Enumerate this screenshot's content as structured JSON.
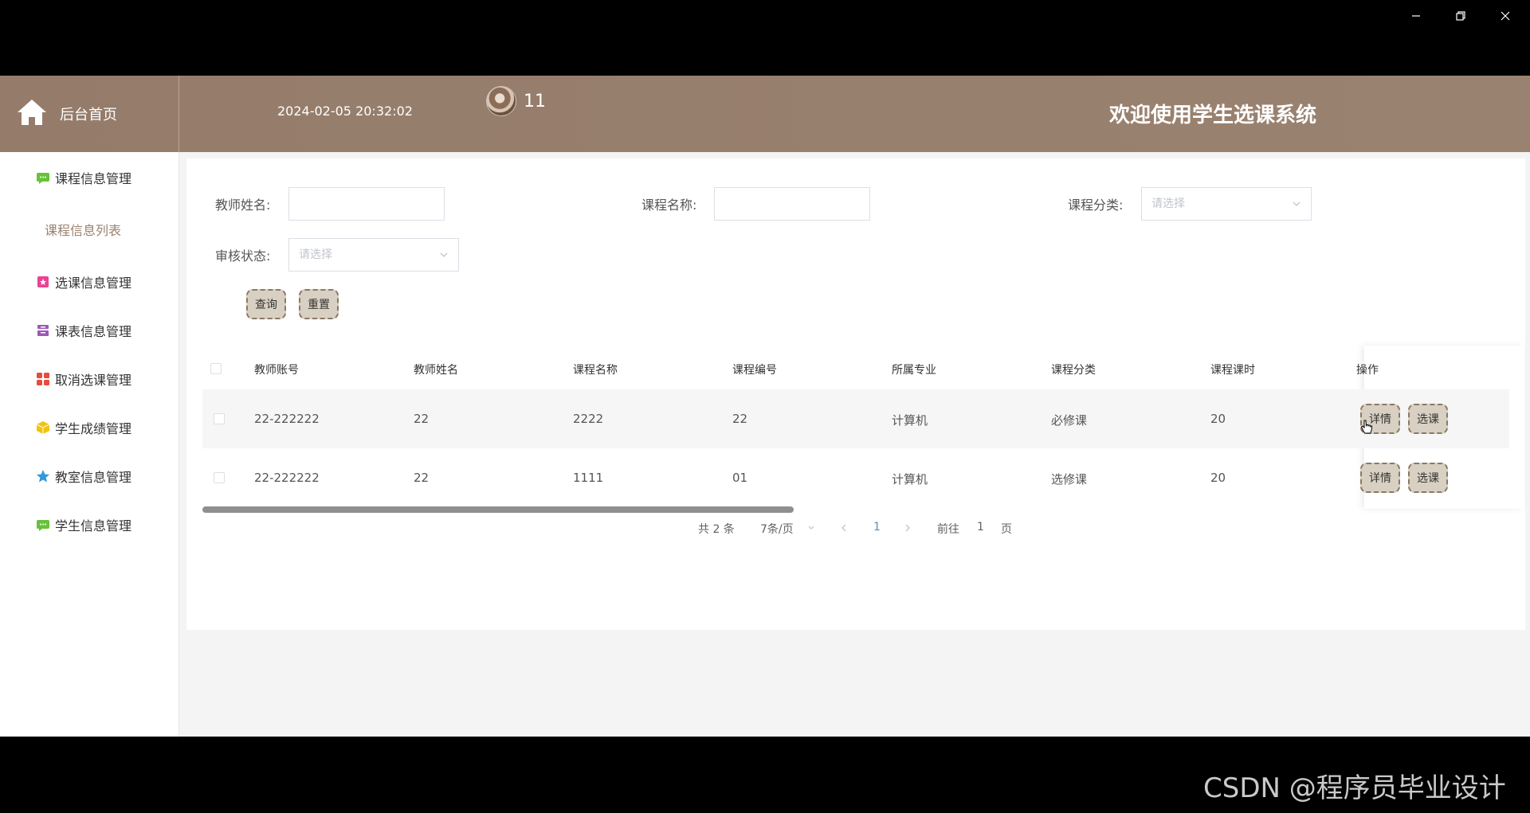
{
  "window": {
    "controls": [
      "minimize",
      "restore",
      "close"
    ]
  },
  "header": {
    "home_label": "后台首页",
    "datetime": "2024-02-05 20:32:02",
    "username": "11",
    "welcome": "欢迎使用学生选课系统"
  },
  "sidebar": {
    "items": [
      {
        "label": "课程信息管理",
        "icon": "chat-icon",
        "color": "#67c23a"
      },
      {
        "label": "选课信息管理",
        "icon": "calendar-icon",
        "color": "#e84393"
      },
      {
        "label": "课表信息管理",
        "icon": "archive-icon",
        "color": "#9b59b6"
      },
      {
        "label": "取消选课管理",
        "icon": "grid-icon",
        "color": "#e74c3c"
      },
      {
        "label": "学生成绩管理",
        "icon": "cube-icon",
        "color": "#f1c40f"
      },
      {
        "label": "教室信息管理",
        "icon": "star-icon",
        "color": "#3498db"
      },
      {
        "label": "学生信息管理",
        "icon": "chat-icon",
        "color": "#67c23a"
      }
    ],
    "subitem": "课程信息列表"
  },
  "search": {
    "teacher_name_label": "教师姓名:",
    "course_name_label": "课程名称:",
    "category_label": "课程分类:",
    "category_placeholder": "请选择",
    "review_label": "审核状态:",
    "review_placeholder": "请选择",
    "query_button": "查询",
    "reset_button": "重置"
  },
  "table": {
    "headers": [
      "教师账号",
      "教师姓名",
      "课程名称",
      "课程编号",
      "所属专业",
      "课程分类",
      "课程课时",
      "操作"
    ],
    "rows": [
      [
        "22-222222",
        "22",
        "2222",
        "22",
        "计算机",
        "必修课",
        "20"
      ],
      [
        "22-222222",
        "22",
        "1111",
        "01",
        "计算机",
        "选修课",
        "20"
      ]
    ],
    "detail_button": "详情",
    "select_button": "选课"
  },
  "pagination": {
    "total": "共 2 条",
    "page_size": "7条/页",
    "current_page": "1",
    "goto_label": "前往",
    "goto_value": "1",
    "page_suffix": "页"
  },
  "watermark": "CSDN @程序员毕业设计"
}
